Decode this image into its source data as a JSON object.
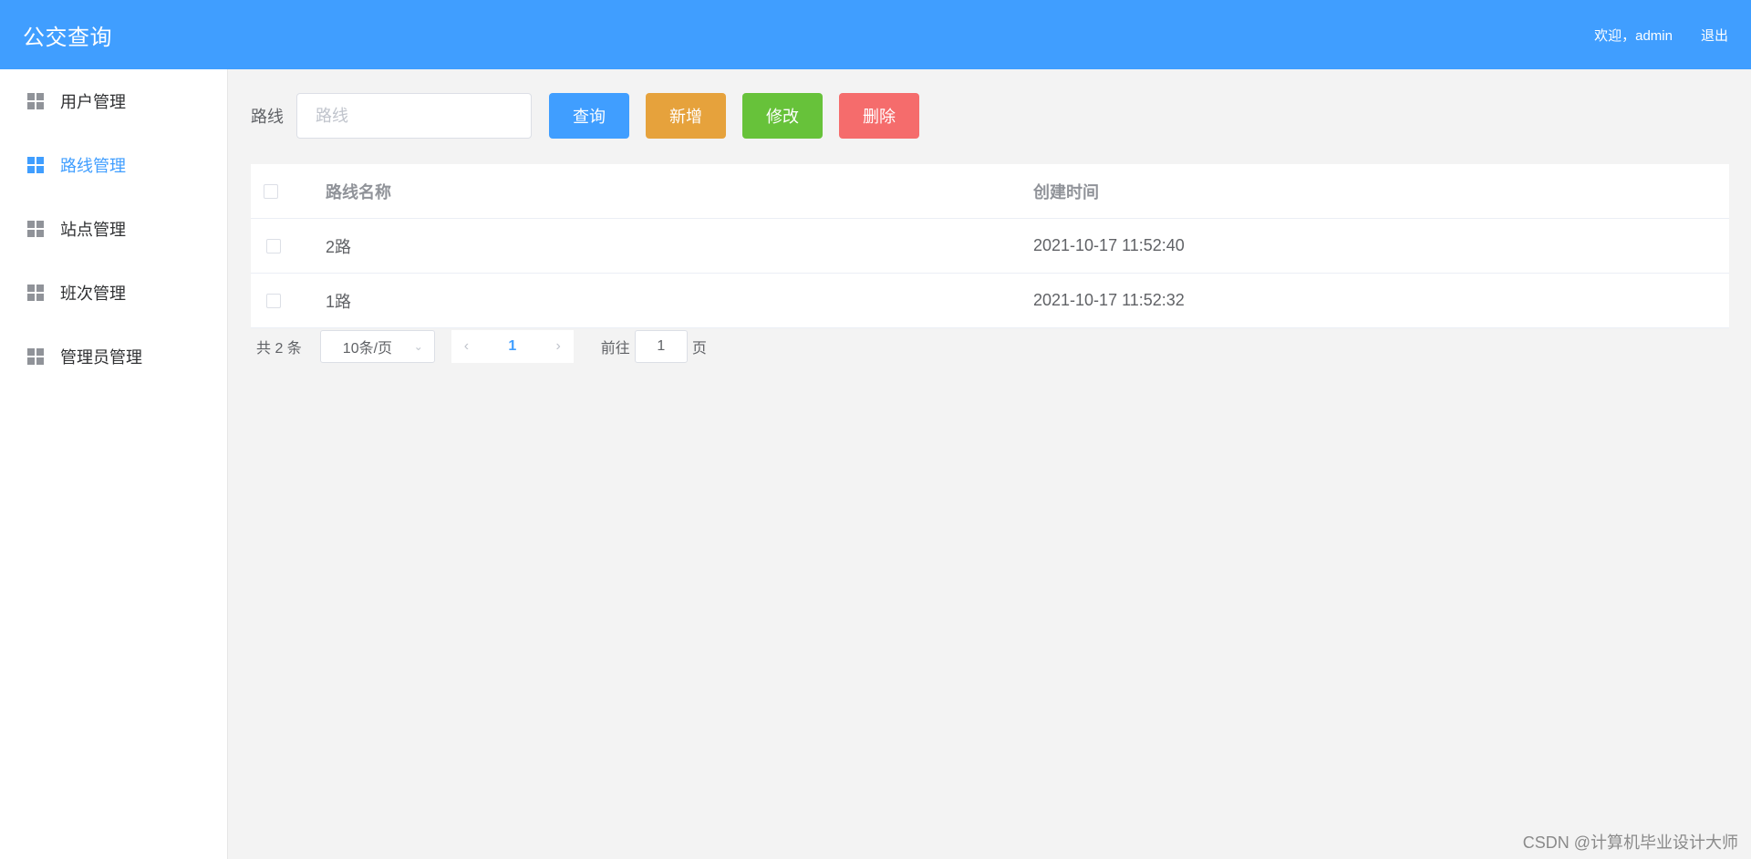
{
  "header": {
    "title": "公交查询",
    "welcome": "欢迎，admin",
    "logout": "退出"
  },
  "sidebar": {
    "items": [
      {
        "label": "用户管理",
        "icon": "grid-icon",
        "active": false
      },
      {
        "label": "路线管理",
        "icon": "grid-icon",
        "active": true
      },
      {
        "label": "站点管理",
        "icon": "grid-icon",
        "active": false
      },
      {
        "label": "班次管理",
        "icon": "grid-icon",
        "active": false
      },
      {
        "label": "管理员管理",
        "icon": "grid-icon",
        "active": false
      }
    ]
  },
  "toolbar": {
    "search_label": "路线",
    "search_placeholder": "路线",
    "search_value": "",
    "query_label": "查询",
    "add_label": "新增",
    "edit_label": "修改",
    "delete_label": "删除"
  },
  "table": {
    "columns": [
      "路线名称",
      "创建时间"
    ],
    "rows": [
      {
        "name": "2路",
        "created": "2021-10-17 11:52:40"
      },
      {
        "name": "1路",
        "created": "2021-10-17 11:52:32"
      }
    ]
  },
  "pagination": {
    "total_text": "共 2 条",
    "page_size": "10条/页",
    "current_page": "1",
    "goto_label": "前往",
    "goto_value": "1",
    "page_unit": "页"
  },
  "watermark": "CSDN @计算机毕业设计大师",
  "colors": {
    "primary": "#409eff",
    "warning": "#e6a23c",
    "success": "#67c23a",
    "danger": "#f56c6c"
  }
}
